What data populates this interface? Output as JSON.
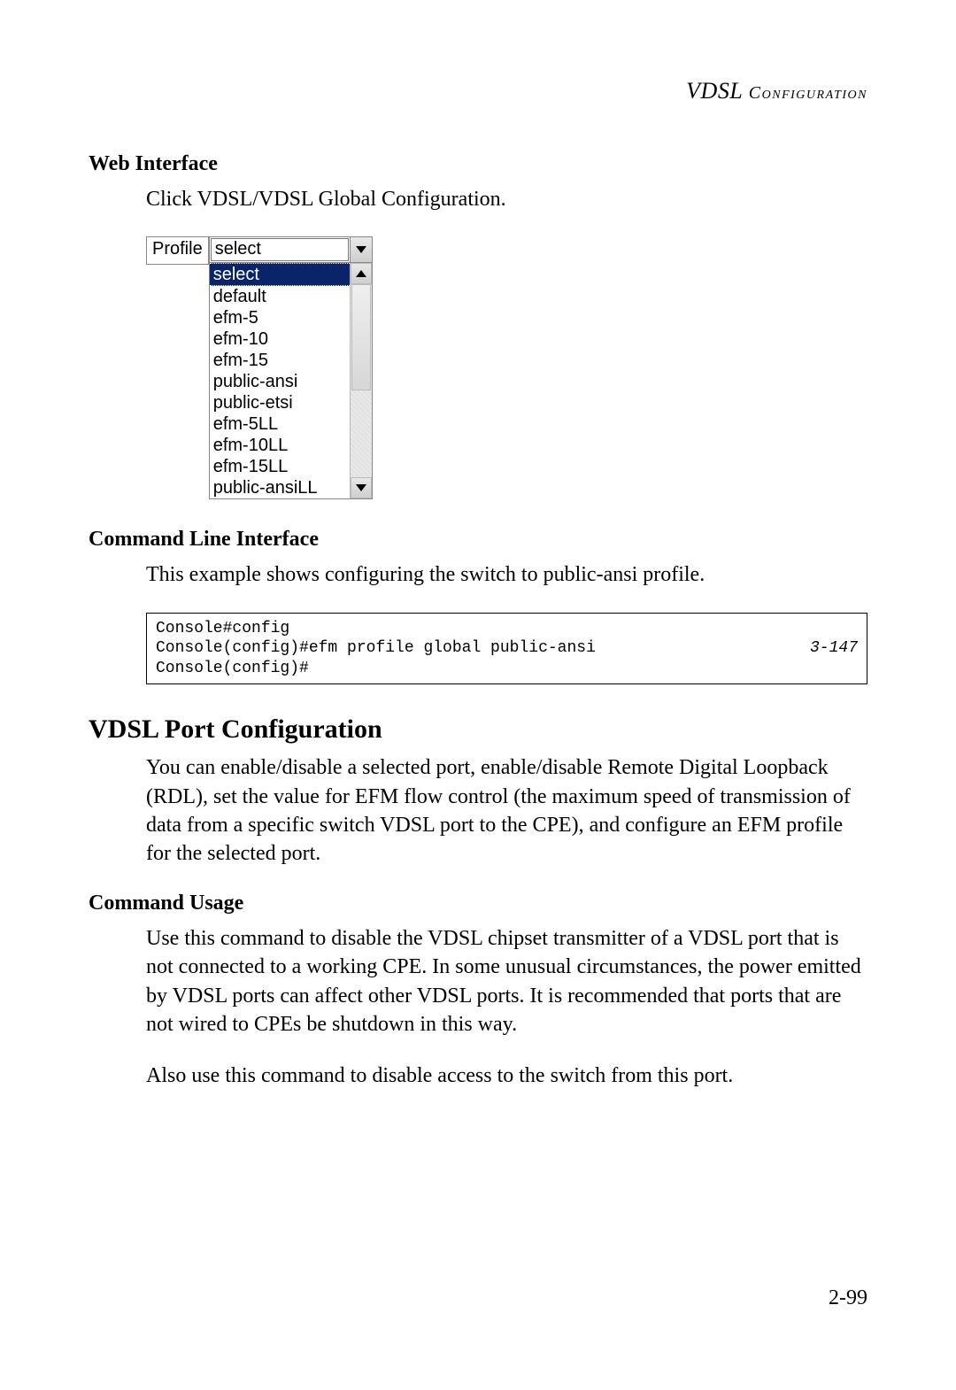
{
  "running_header": {
    "main": "VDSL",
    "tail_sc": " Configuration"
  },
  "section_web": {
    "heading": "Web Interface",
    "para": "Click VDSL/VDSL Global Configuration."
  },
  "profile_widget": {
    "label": "Profile",
    "selected": "select",
    "options": [
      "select",
      "default",
      "efm-5",
      "efm-10",
      "efm-15",
      "public-ansi",
      "public-etsi",
      "efm-5LL",
      "efm-10LL",
      "efm-15LL",
      "public-ansiLL"
    ]
  },
  "section_cli": {
    "heading": "Command Line Interface",
    "para": "This example shows configuring the switch to public-ansi profile.",
    "code": "Console#config\nConsole(config)#efm profile global public-ansi\nConsole(config)#",
    "ref": "3-147"
  },
  "section_port": {
    "heading": "VDSL Port Configuration",
    "para": "You can enable/disable a selected port, enable/disable Remote Digital Loopback (RDL), set the value for EFM flow control (the maximum speed of transmission of data from a specific switch VDSL port to the CPE), and configure an EFM profile for the selected port."
  },
  "section_usage": {
    "heading": "Command Usage",
    "para1": "Use this command to disable the VDSL chipset transmitter of a VDSL port that is not connected to a working CPE. In some unusual circumstances, the power emitted by VDSL ports can affect other VDSL ports. It is recommended that ports that are not wired to CPEs be shutdown in this way.",
    "para2": "Also use this command to disable access to the switch from this port."
  },
  "page_number": "2-99"
}
